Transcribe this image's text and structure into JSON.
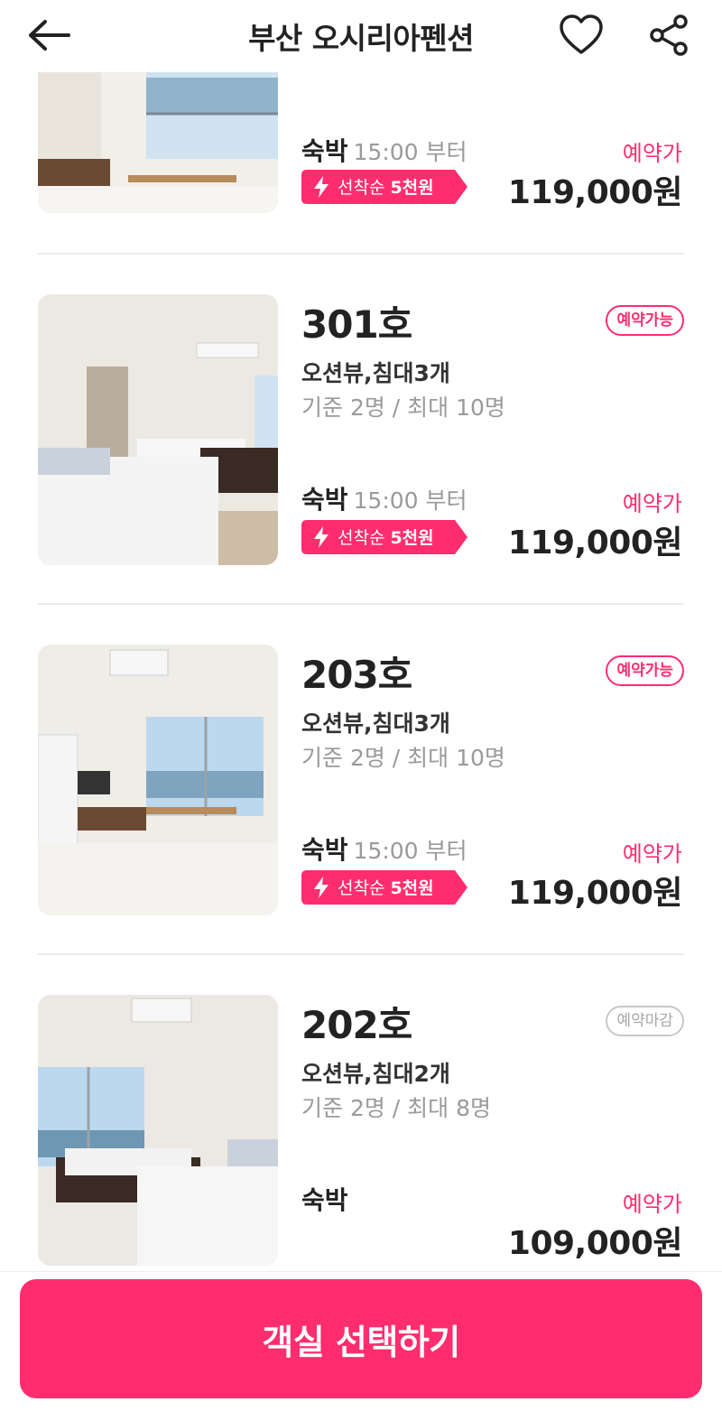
{
  "header": {
    "title": "부산 오시리아펜션"
  },
  "icons": {
    "back": "arrow-left-icon",
    "favorite": "heart-icon",
    "share": "share-icon"
  },
  "colors": {
    "accent": "#ff2d6f",
    "text": "#222222",
    "muted": "#9a9a9a"
  },
  "rooms": [
    {
      "name": "",
      "stay": "숙박",
      "time": "15:00 부터",
      "coupon_prefix": "선착순",
      "coupon_amount": "5천원",
      "price_label": "예약가",
      "price": "119,000원"
    },
    {
      "name": "301호",
      "badge": "예약가능",
      "type": "오션뷰,침대3개",
      "capacity": "기준 2명 / 최대 10명",
      "stay": "숙박",
      "time": "15:00 부터",
      "coupon_prefix": "선착순",
      "coupon_amount": "5천원",
      "price_label": "예약가",
      "price": "119,000원"
    },
    {
      "name": "203호",
      "badge": "예약가능",
      "type": "오션뷰,침대3개",
      "capacity": "기준 2명 / 최대 10명",
      "stay": "숙박",
      "time": "15:00 부터",
      "coupon_prefix": "선착순",
      "coupon_amount": "5천원",
      "price_label": "예약가",
      "price": "119,000원"
    },
    {
      "name": "202호",
      "badge": "예약마감",
      "type": "오션뷰,침대2개",
      "capacity": "기준 2명 / 최대 8명",
      "stay": "숙박",
      "price_label": "예약가",
      "price": "109,000원"
    }
  ],
  "cta": {
    "label": "객실 선택하기"
  }
}
